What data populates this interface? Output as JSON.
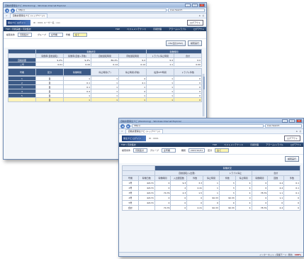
{
  "w1": {
    "title": "自動倉庫保全ナビ (Monitoring) - Windows Internet Explorer",
    "url": "http://",
    "search": "Live Search",
    "tab": "自動倉庫保全ナビ (トップページ)",
    "logo": "保全ナビ ログイン",
    "user": "ID : 0001 ユーザー名 : xxx",
    "logout": "ログアウト",
    "nav_title": "TOP / 月間実績 / 月次集計",
    "nav": [
      "TOP",
      "ベストメンテナンス",
      "月報管理",
      "アラーム/トラブル",
      "ログアウト"
    ],
    "cond": [
      {
        "label": "検索条件",
        "value": "月別集計"
      },
      {
        "label": "グループ",
        "value": "全号機",
        "label2": "号機",
        "value2": "全て"
      }
    ],
    "buttons": [
      "CSV出力(CSV)",
      "検索実行"
    ],
    "t1": {
      "group1": "稼働状況",
      "group2": "稼働時間",
      "headers": [
        "稼働率(自動運転)",
        "稼働率(自動+手動)",
        "自動運転時間",
        "手動運転時間",
        "トラブル停止時間",
        "合計"
      ],
      "rows": [
        {
          "label": "自動倉庫",
          "cells": [
            "9,4%",
            "9,4%",
            "89.4%",
            "9,4",
            "9.4",
            "0.0"
          ]
        },
        {
          "label": "二号",
          "cells": [
            "0.01",
            "0.44",
            "0.14",
            "0.14",
            "1.1",
            "0.00"
          ]
        }
      ]
    },
    "t2": {
      "headers": [
        "号機",
        "区分",
        "稼働時間",
        "停止時間(ア)",
        "停止時間(手動)",
        "電源OFF時間",
        "トラブル件数"
      ],
      "rows": [
        [
          "1",
          "自",
          "1",
          "1",
          "4",
          "1",
          "0"
        ],
        [
          "2",
          "自",
          "0.1",
          "1",
          "4.1",
          "1",
          "0"
        ],
        [
          "3",
          "自",
          "0.1",
          "1",
          "1",
          "1",
          "0"
        ],
        [
          "4",
          "自",
          "0.4",
          "1",
          "4",
          "1",
          "0"
        ],
        [
          "5",
          "自",
          "1",
          "1",
          "1",
          "1",
          "0"
        ],
        [
          "6",
          "自",
          "1",
          "1",
          "1",
          "1",
          "0"
        ]
      ]
    }
  },
  "w2": {
    "title": "自動倉庫保全ナビ (Monitoring) - Windows Internet Explorer",
    "url": "http://",
    "search": "Live Search",
    "tab": "自動倉庫保全ナビ (トップページ)",
    "logo": "保全ナビ ログイン",
    "user": "ID : 0001",
    "logout": "ログアウト",
    "nav_title": "TOP / 月次集計",
    "nav": [
      "TOP",
      "ベストメンテナンス",
      "月報管理",
      "アラーム/トラブル",
      "ログアウト"
    ],
    "cond": [
      {
        "label": "検索条件",
        "value": "月別集計",
        "label2": "グループ",
        "value2": "全号機"
      },
      {
        "label": "期間",
        "value": "2007/10/01",
        "label2": "区分",
        "value2": "全て"
      }
    ],
    "buttons": [
      "検索実行"
    ],
    "t": {
      "group": "稼働状況",
      "sub": [
        "自動運転(入出庫)",
        "トラブル停止",
        "合計"
      ],
      "heads": [
        "号機",
        "稼働日数",
        "稼働時間",
        "入出庫回数",
        "件数",
        "停止時間",
        "件数",
        "停止時間",
        "稼働時間",
        "回数",
        "件数"
      ],
      "rows": [
        [
          "1号",
          "42174",
          "0",
          "9.3",
          "3.3",
          "1",
          "3",
          "4",
          "0",
          "4.4",
          "0.1"
        ],
        [
          "2号",
          "42174",
          "0",
          "2",
          "2.41",
          "1",
          "3",
          "4",
          "0",
          "4.4",
          "0.1"
        ],
        [
          "3号",
          "42174",
          "74.79",
          "2.3",
          "1.5",
          "1",
          "3",
          "4",
          "78.79",
          "1.1",
          "0.1"
        ],
        [
          "4号",
          "42174",
          "0",
          "0",
          "0",
          "90.33",
          "90.33",
          "0",
          "0",
          "1.1",
          "0"
        ],
        [
          "5号",
          "42174",
          "0",
          "0",
          "0",
          "0",
          "0",
          "4",
          "0",
          "0",
          "0"
        ],
        [
          "合計",
          "",
          "74.79",
          "0",
          "2.21",
          "90.33",
          "90.33",
          "4",
          "78.79",
          "4.4",
          "0"
        ]
      ]
    },
    "status": "インターネット | 保護モード: 無効",
    "zoom": "100%"
  }
}
